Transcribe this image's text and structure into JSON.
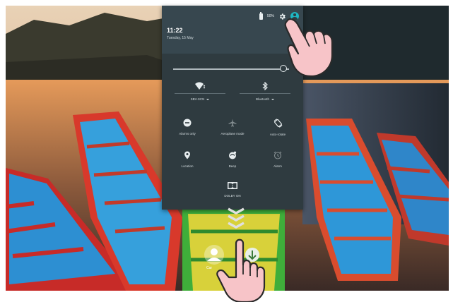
{
  "status_bar": {
    "battery_text": "50%",
    "icons": [
      "battery-icon",
      "gear-icon",
      "account-icon"
    ]
  },
  "header": {
    "time": "11:22",
    "date": "Tuesday, 15 May"
  },
  "brightness": {
    "level": 0.95
  },
  "toggles": [
    {
      "label": "SBV-SCN",
      "icon": "wifi-icon"
    },
    {
      "label": "Bluetooth",
      "icon": "bluetooth-icon"
    }
  ],
  "tiles": [
    {
      "label": "Alarms only",
      "icon": "do-not-disturb-icon"
    },
    {
      "label": "Aeroplane mode",
      "icon": "airplane-icon"
    },
    {
      "label": "Auto-rotate",
      "icon": "auto-rotate-icon"
    },
    {
      "label": "Location",
      "icon": "location-icon"
    },
    {
      "label": "Beep",
      "icon": "beep-icon"
    },
    {
      "label": "Alarm",
      "icon": "alarm-icon"
    },
    {
      "label": "DOLBY ON",
      "icon": "dolby-icon"
    }
  ],
  "underlying_label": "Car",
  "colors": {
    "panel": "#2f3b40",
    "accent": "#1eb5c2",
    "hand": "#f7c4c8"
  }
}
